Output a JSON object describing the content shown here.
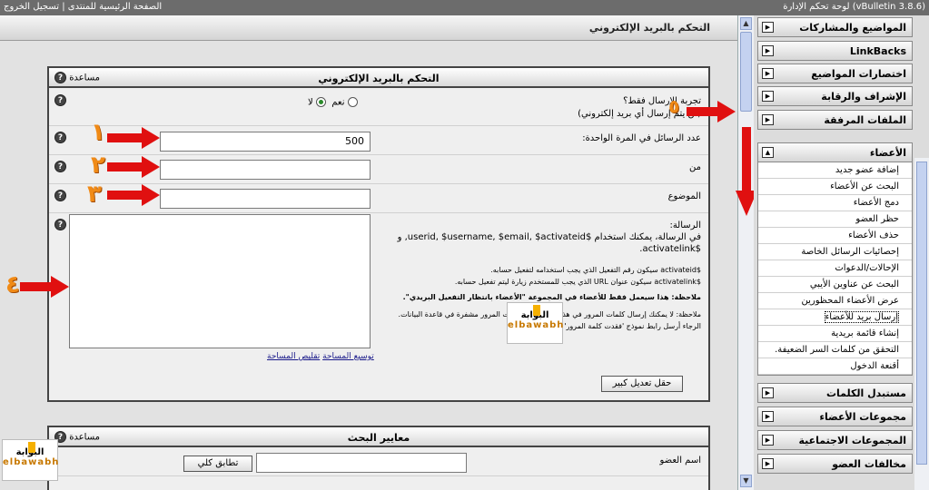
{
  "topbar": {
    "title": "لوحة تحكم الإدارة (vBulletin 3.8.6)",
    "links": "الصفحة الرئيسية للمنتدى | تسجيل الخروج"
  },
  "header": {
    "title": "التحكم بالبريد الإلكتروني"
  },
  "panel": {
    "title": "التحكم بالبريد الإلكتروني",
    "help": "مساعدة",
    "test": {
      "label": "تجربة الإرسال فقط؟",
      "sub": "(لن يتم إرسال أي بريد إلكتروني)",
      "yes": "نعم",
      "no": "لا"
    },
    "perpage": {
      "label": "عدد الرسائل في المرة الواحدة:",
      "value": "500"
    },
    "from": {
      "label": "من",
      "value": ""
    },
    "subject": {
      "label": "الموضوع",
      "value": ""
    },
    "message": {
      "label": "الرسالة:",
      "desc1": "في الرسالة، يمكنك استخدام $userid, $username, $email, $activateid, و $activatelink.",
      "desc2": "$activateid سيكون رقم التفعيل الذي يجب استخدامه لتفعيل حسابه.",
      "desc3": "$activatelink سيكون عنوان URL الذي يجب للمستخدم زيارة ليتم تفعيل حسابه.",
      "desc4": "ملاحظة: هذا سيعمل فقط للأعضاء في المجموعة \"الأعضاء بانتظار التفعيل البريدي\".",
      "desc5": "ملاحظة: لا يمكنك إرسال كلمات المرور في هذا النموذج لأن كلمات المرور مشفرة في قاعدة البيانات. الرجاء أرسل رابط نموذج 'فقدت كلمة المرور' بدلاً عن هذا.",
      "expand": "توسيع المساحة",
      "shrink": "تقليص المساحة",
      "big": "حقل تعديل كبير"
    }
  },
  "panel2": {
    "title": "معايير البحث",
    "help": "مساعدة",
    "username": {
      "label": "اسم العضو",
      "value": ""
    },
    "exact": "تطابق كلي"
  },
  "sidebar": {
    "top": [
      "المواضيع والمشاركات",
      "LinkBacks",
      "اختصارات المواضيع",
      "الإشراف والرقابة",
      "الملفات المرفقة"
    ],
    "members": {
      "title": "الأعضاء",
      "items": [
        "إضافة عضو جديد",
        "البحث عن الأعضاء",
        "دمج الأعضاء",
        "حظر العضو",
        "حذف الأعضاء",
        "إحصائيات الرسائل الخاصة",
        "الإحالات/الدعوات",
        "البحث عن عناوين الأيبي",
        "عرض الأعضاء المحظورين",
        "إرسال بريد للأعضاء",
        "إنشاء قائمة بريدية",
        "التحقق من كلمات السر الضعيفة.",
        "أقنعة الدخول"
      ]
    },
    "bottom": [
      "مستبدل الكلمات",
      "مجموعات الأعضاء",
      "المجموعات الاجتماعية",
      "مخالفات العضو"
    ]
  },
  "annotations": [
    "١",
    "٢",
    "٣",
    "٤",
    "٥"
  ],
  "logo": {
    "ar": "البوابة",
    "en": "elbawabh"
  },
  "colors": {
    "arrow": "#e01010",
    "number": "#f08a16"
  }
}
